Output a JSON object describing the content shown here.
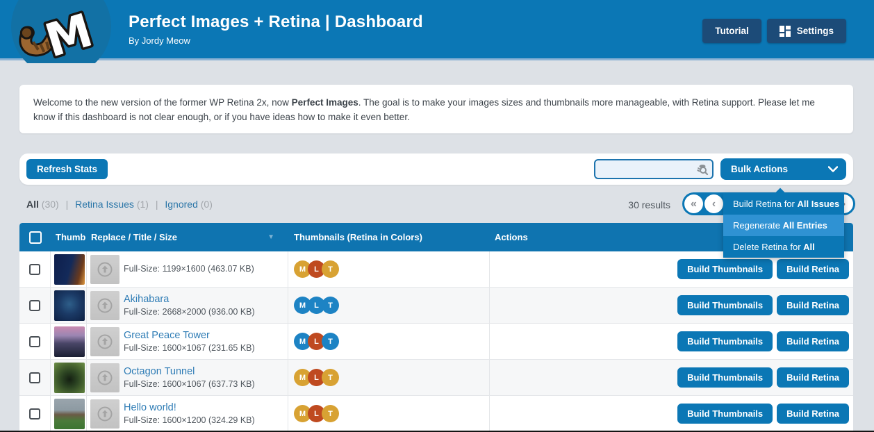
{
  "header": {
    "title": "Perfect Images + Retina | Dashboard",
    "subtitle": "By Jordy Meow",
    "tutorial_label": "Tutorial",
    "settings_label": "Settings"
  },
  "welcome": {
    "text_before": "Welcome to the new version of the former WP Retina 2x, now ",
    "bold": "Perfect Images",
    "text_after": ". The goal is to make your images sizes and thumbnails more manageable, with Retina support. Please let me know if this dashboard is not clear enough, or if you have ideas how to make it even better."
  },
  "toolbar": {
    "refresh_label": "Refresh Stats",
    "search_value": "",
    "bulk_actions_label": "Bulk Actions"
  },
  "bulk_menu": {
    "items": [
      {
        "pre": "Build Retina for ",
        "bold": "All Issues",
        "highlighted": false
      },
      {
        "pre": "Regenerate ",
        "bold": "All Entries",
        "highlighted": true
      },
      {
        "pre": "Delete Retina for ",
        "bold": "All",
        "highlighted": false
      }
    ]
  },
  "filters": {
    "all_label": "All",
    "all_count": "(30)",
    "retina_label": "Retina Issues",
    "retina_count": "(1)",
    "ignored_label": "Ignored",
    "ignored_count": "(0)",
    "separator": "|",
    "results": "30 results"
  },
  "pagination": {
    "first": "«",
    "prev": "‹",
    "next": "›"
  },
  "table": {
    "headers": {
      "thumb": "Thumb",
      "replace": "Replace / Title / Size",
      "thumbnails": "Thumbnails (Retina in Colors)",
      "actions": "Actions",
      "sort_indicator": "▼"
    },
    "row_buttons": {
      "thumbnails": "Build Thumbnails",
      "retina": "Build Retina"
    },
    "badge_colors": {
      "yellow": "#d8a233",
      "red": "#bf4a20",
      "blue": "#1d83c4"
    },
    "rows": [
      {
        "title": "",
        "fullsize": "Full-Size: 1199×1600 (463.07 KB)",
        "badges": [
          {
            "letter": "M",
            "color": "#d8a233"
          },
          {
            "letter": "L",
            "color": "#bf4a20"
          },
          {
            "letter": "T",
            "color": "#d8a233"
          }
        ],
        "thumb_gradient": "linear-gradient(105deg,#0e1e4b 0%,#132a5a 50%,#6b3a1c 80%,#e09a40 100%)"
      },
      {
        "title": "Akihabara",
        "fullsize": "Full-Size: 2668×2000 (936.00 KB)",
        "badges": [
          {
            "letter": "M",
            "color": "#1d83c4"
          },
          {
            "letter": "L",
            "color": "#1d83c4"
          },
          {
            "letter": "T",
            "color": "#1d83c4"
          }
        ],
        "thumb_gradient": "radial-gradient(circle at 50% 45%,#2e5f8a 0%,#1b3a66 45%,#0d1f42 100%)"
      },
      {
        "title": "Great Peace Tower",
        "fullsize": "Full-Size: 1600×1067 (231.65 KB)",
        "badges": [
          {
            "letter": "M",
            "color": "#1d83c4"
          },
          {
            "letter": "L",
            "color": "#bf4a20"
          },
          {
            "letter": "T",
            "color": "#1d83c4"
          }
        ],
        "thumb_gradient": "linear-gradient(180deg,#c98ab0 0%,#9b86b2 30%,#4a4668 55%,#1a1f33 100%)"
      },
      {
        "title": "Octagon Tunnel",
        "fullsize": "Full-Size: 1600×1067 (637.73 KB)",
        "badges": [
          {
            "letter": "M",
            "color": "#d8a233"
          },
          {
            "letter": "L",
            "color": "#bf4a20"
          },
          {
            "letter": "T",
            "color": "#d8a233"
          }
        ],
        "thumb_gradient": "radial-gradient(circle at 50% 55%,#141f12 0%,#2c4422 35%,#4d6b33 70%,#6f9149 100%)"
      },
      {
        "title": "Hello world!",
        "fullsize": "Full-Size: 1600×1200 (324.29 KB)",
        "badges": [
          {
            "letter": "M",
            "color": "#d8a233"
          },
          {
            "letter": "L",
            "color": "#bf4a20"
          },
          {
            "letter": "T",
            "color": "#d8a233"
          }
        ],
        "thumb_gradient": "linear-gradient(180deg,#9aa5ad 0%,#8d9aa2 38%,#6b5b46 52%,#4a7a3a 72%,#3c7531 100%)"
      }
    ]
  }
}
